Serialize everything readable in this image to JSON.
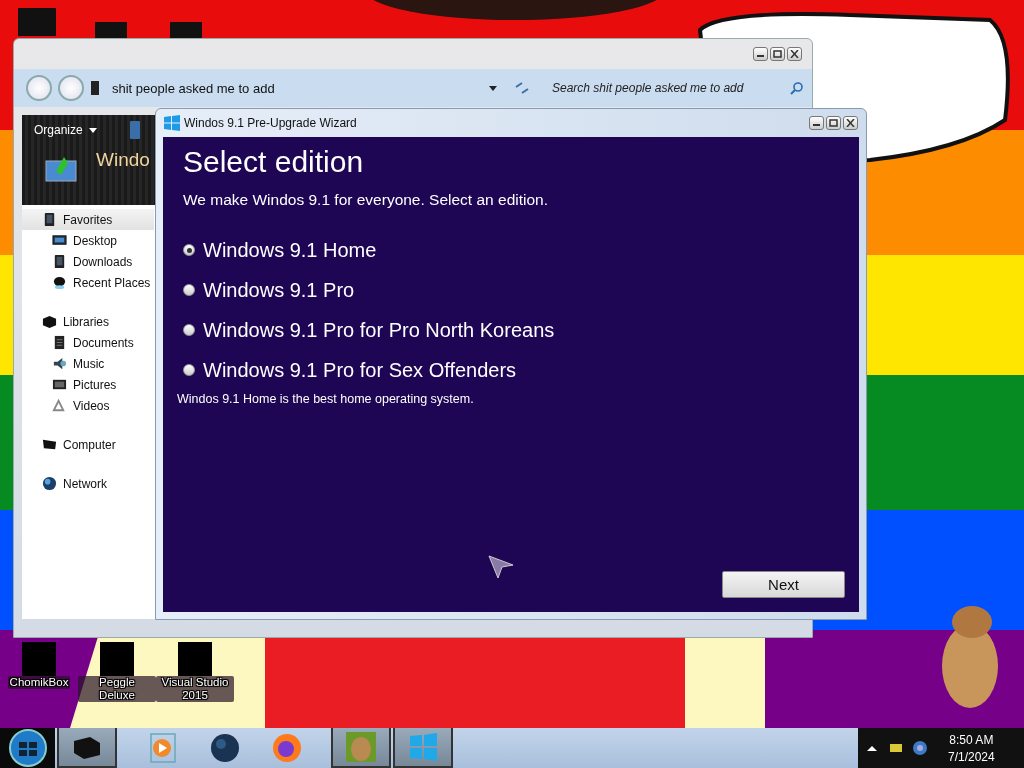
{
  "desktop": {
    "icons": [
      {
        "label": "ChomikBox"
      },
      {
        "label": "Peggle Deluxe"
      },
      {
        "label": "Visual Studio 2015"
      }
    ]
  },
  "explorer": {
    "address": "shit people asked me to add",
    "search": {
      "placeholder": "Search shit people asked me to add"
    },
    "toolbar": {
      "organize": "Organize"
    },
    "header": "Windo",
    "sidebar": [
      {
        "label": "Favorites",
        "selected": true,
        "children": [
          {
            "label": "Desktop",
            "selected": false
          },
          {
            "label": "Downloads",
            "selected": false
          },
          {
            "label": "Recent Places",
            "selected": false
          }
        ]
      },
      {
        "label": "Libraries",
        "selected": false,
        "children": [
          {
            "label": "Documents",
            "selected": false
          },
          {
            "label": "Music",
            "selected": false
          },
          {
            "label": "Pictures",
            "selected": false
          },
          {
            "label": "Videos",
            "selected": false
          }
        ]
      },
      {
        "label": "Computer",
        "selected": false
      },
      {
        "label": "Network",
        "selected": false
      }
    ]
  },
  "wizard": {
    "window": {
      "title": "Windos 9.1 Pre-Upgrade Wizard"
    },
    "heading": "Select edition",
    "subtitle": "We make Windos 9.1 for everyone. Select an edition.",
    "editions": [
      {
        "label": "Windows 9.1 Home",
        "selected": true
      },
      {
        "label": "Windows 9.1 Pro",
        "selected": false
      },
      {
        "label": "Windows 9.1 Pro for Pro North Koreans",
        "selected": false
      },
      {
        "label": "Windows 9.1 Pro for Sex Offenders",
        "selected": false
      }
    ],
    "description": "Windos 9.1 Home is the best home operating system.",
    "next_button": "Next"
  },
  "taskbar": {
    "clock": {
      "time": "8:50 AM",
      "date": "7/1/2024"
    }
  }
}
